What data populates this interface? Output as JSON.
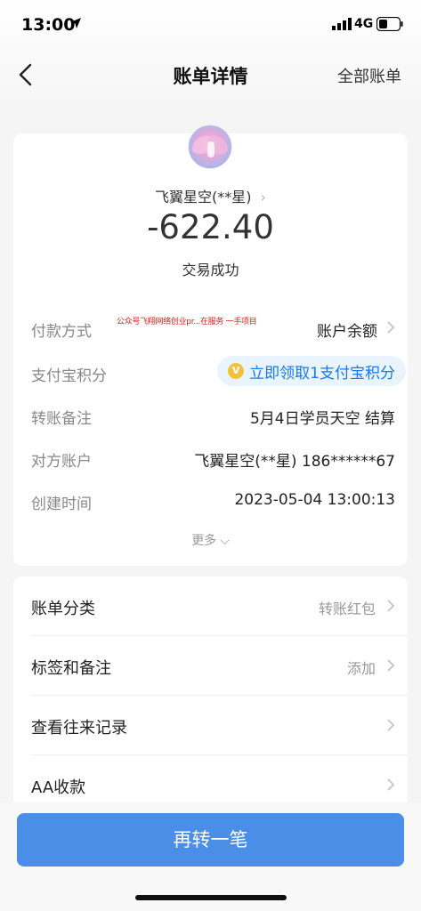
{
  "status_bar": {
    "time": "13:00",
    "network": "4G",
    "icons": [
      "location-arrow-icon",
      "signal-icon",
      "battery-icon"
    ]
  },
  "nav": {
    "title": "账单详情",
    "right_link": "全部账单",
    "back_icon": "chevron-left-icon"
  },
  "transaction": {
    "payee": "飞翼星空(**星)",
    "amount": "-622.40",
    "status": "交易成功"
  },
  "details": [
    {
      "label": "付款方式",
      "value": "账户余额",
      "has_chevron": true
    },
    {
      "label": "支付宝积分",
      "value": "立即领取1支付宝积分",
      "coin": "V"
    },
    {
      "label": "转账备注",
      "value": "5月4日学员天空 结算"
    },
    {
      "label": "对方账户",
      "value": "飞翼星空(**星) 186******67"
    },
    {
      "label": "创建时间",
      "value": "2023-05-04 13:00:13"
    }
  ],
  "watermark": "公众号飞翔网络创业pr...在服务 一手项目",
  "more_label": "更多",
  "bottom_rows": [
    {
      "label": "账单分类",
      "value": "转账红包"
    },
    {
      "label": "标签和备注",
      "value": "添加"
    },
    {
      "label": "查看往来记录",
      "value": ""
    },
    {
      "label": "AA收款",
      "value": ""
    }
  ],
  "primary_button": "再转一笔",
  "colors": {
    "accent": "#1677ff",
    "button": "#4b8ee8",
    "points_bg": "#eaf4ff",
    "watermark": "#e21b1b"
  }
}
